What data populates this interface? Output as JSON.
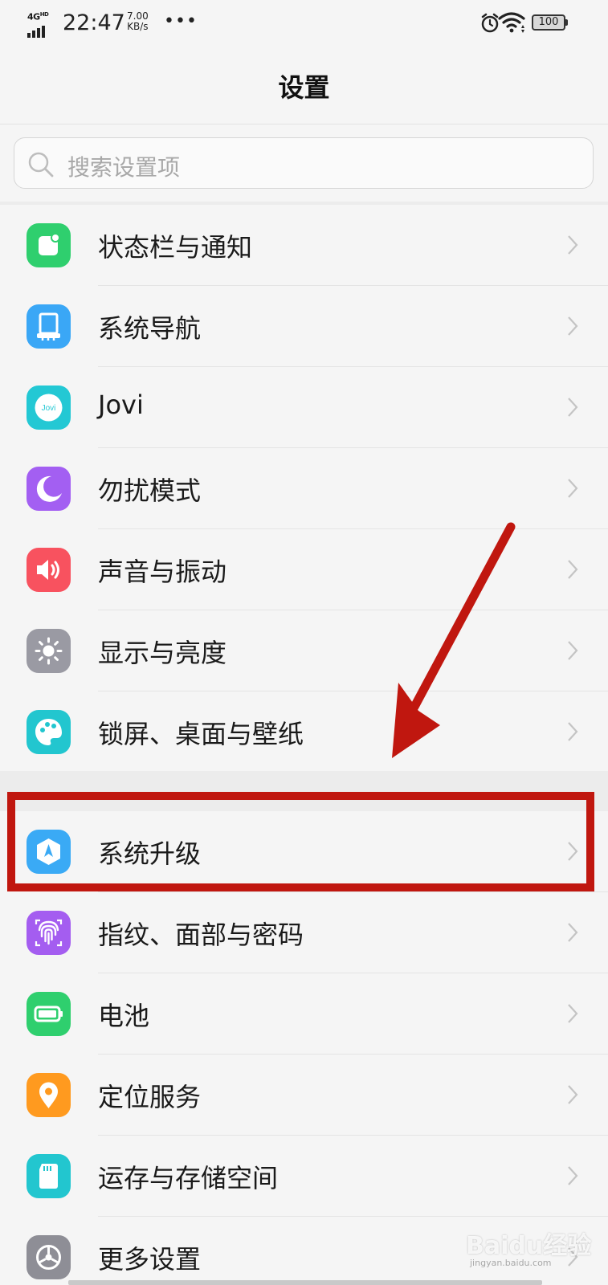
{
  "status_bar": {
    "network": "4G",
    "network_sup": "HD",
    "time": "22:47",
    "speed_value": "7.00",
    "speed_unit": "KB/s",
    "more": "•••",
    "battery": "100"
  },
  "header": {
    "title": "设置"
  },
  "search": {
    "placeholder": "搜索设置项"
  },
  "settings": {
    "items": [
      {
        "label": "状态栏与通知",
        "icon": "notification-icon",
        "color": "#2fcf6e"
      },
      {
        "label": "系统导航",
        "icon": "navigation-icon",
        "color": "#3aa7f6"
      },
      {
        "label": "Jovi",
        "icon": "jovi-icon",
        "color": "#23c8d4"
      },
      {
        "label": "勿扰模式",
        "icon": "moon-icon",
        "color": "#a35ff2"
      },
      {
        "label": "声音与振动",
        "icon": "speaker-icon",
        "color": "#f8525f"
      },
      {
        "label": "显示与亮度",
        "icon": "brightness-icon",
        "color": "#9a9aa3"
      },
      {
        "label": "锁屏、桌面与壁纸",
        "icon": "palette-icon",
        "color": "#22c6cf"
      },
      {
        "label": "系统升级",
        "icon": "system-update-icon",
        "color": "#3aaaf5"
      },
      {
        "label": "指纹、面部与密码",
        "icon": "fingerprint-icon",
        "color": "#a45df0"
      },
      {
        "label": "电池",
        "icon": "battery-icon",
        "color": "#2fcf6e"
      },
      {
        "label": "定位服务",
        "icon": "location-icon",
        "color": "#ff9a1f"
      },
      {
        "label": "运存与存储空间",
        "icon": "storage-icon",
        "color": "#22c6cf"
      },
      {
        "label": "更多设置",
        "icon": "more-settings-icon",
        "color": "#8e8e96"
      }
    ]
  },
  "watermark": {
    "text": "Baidu经验",
    "sub": "jingyan.baidu.com"
  }
}
